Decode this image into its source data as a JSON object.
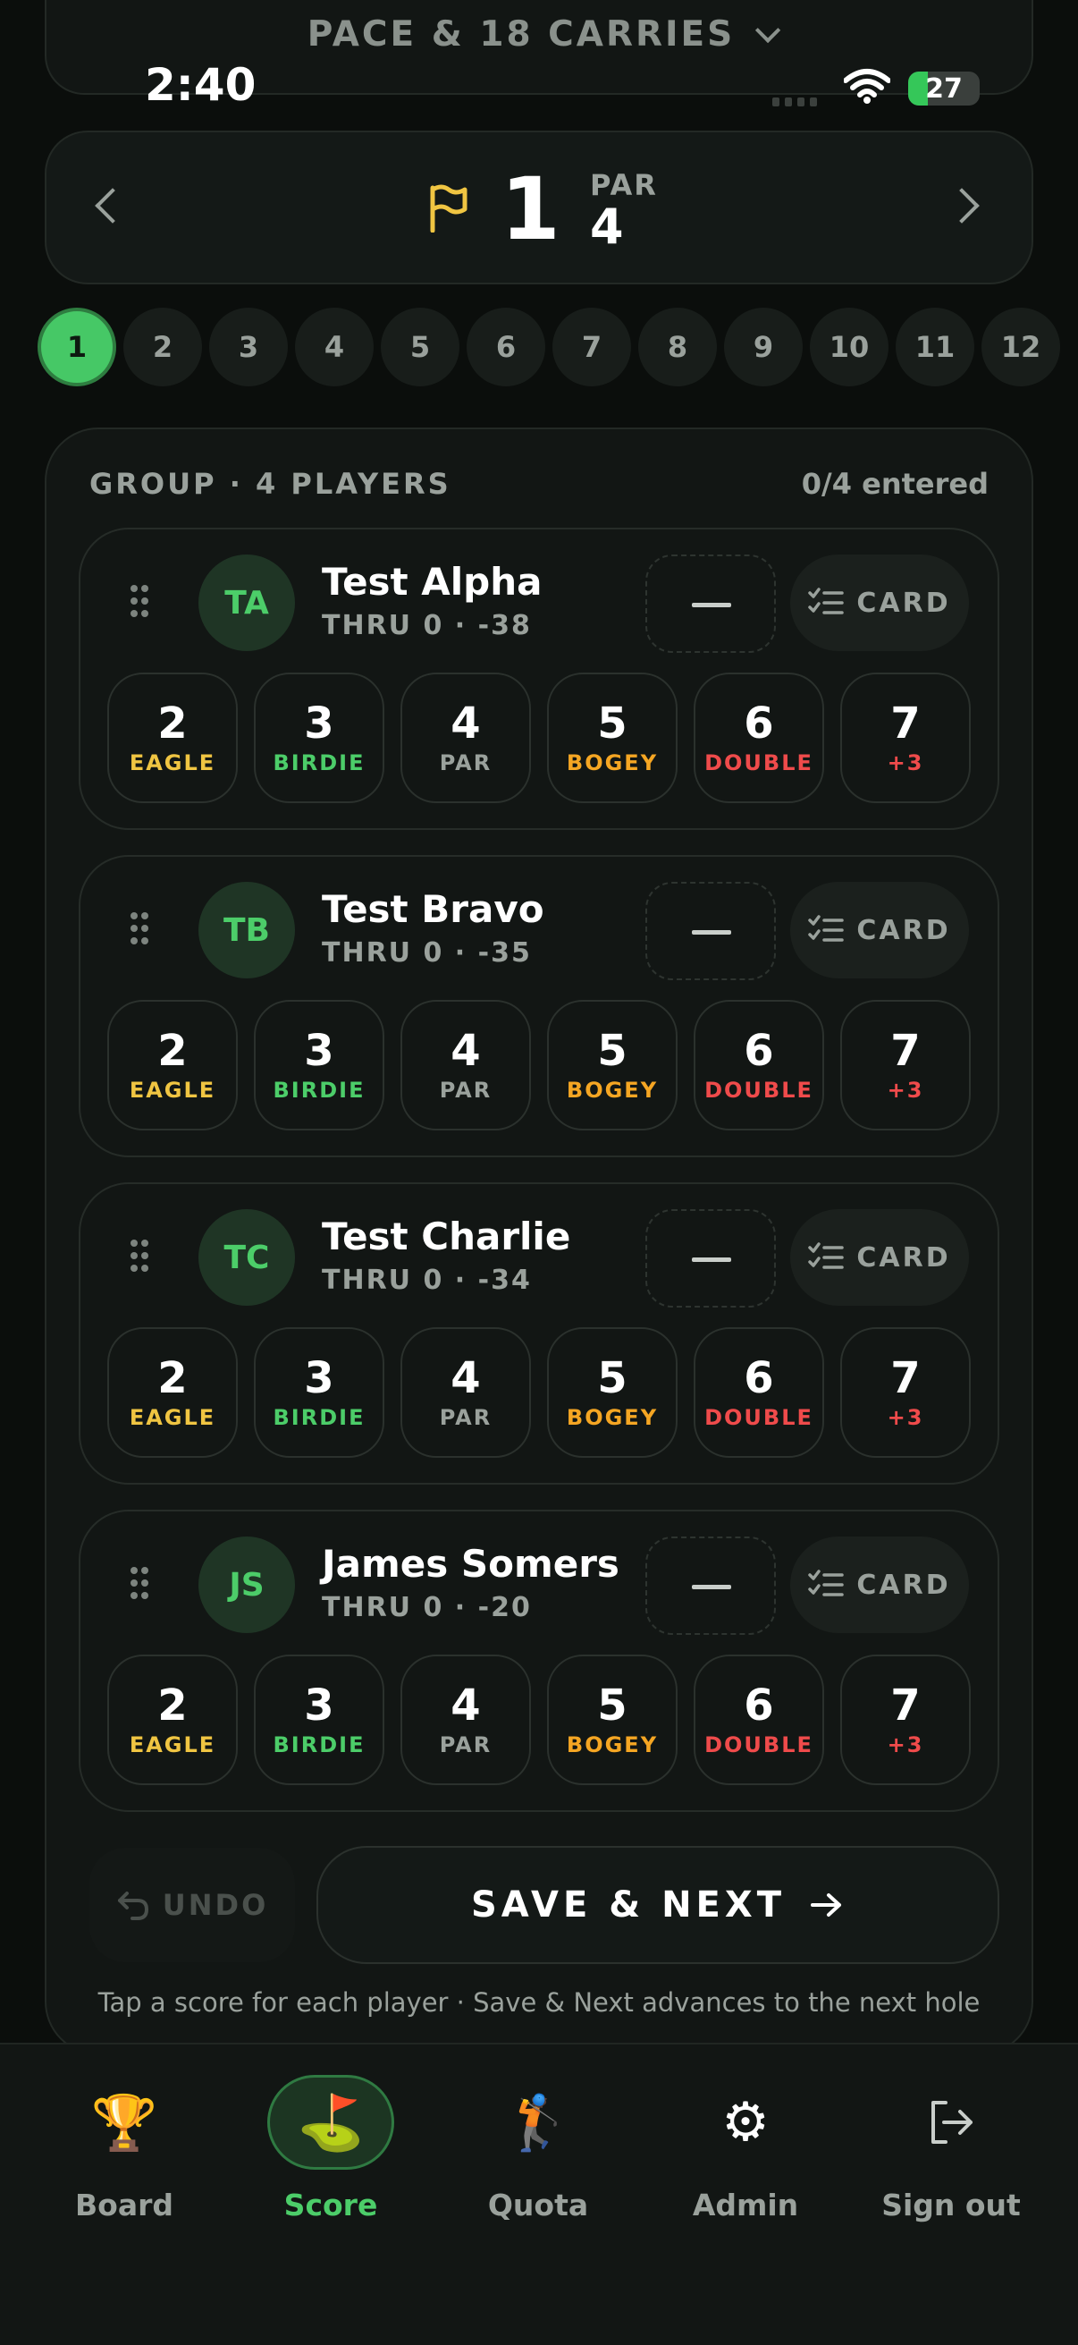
{
  "peek": {
    "title": "PACE & 18 CARRIES"
  },
  "status": {
    "time": "2:40",
    "battery": "27"
  },
  "hole": {
    "number": "1",
    "par_label": "PAR",
    "par": "4"
  },
  "holes": [
    "1",
    "2",
    "3",
    "4",
    "5",
    "6",
    "7",
    "8",
    "9",
    "10",
    "11",
    "12"
  ],
  "active_hole": "1",
  "group": {
    "label": "GROUP · 4 PLAYERS",
    "entered": "0/4 entered"
  },
  "card_label": "CARD",
  "score_options": [
    {
      "n": "2",
      "t": "EAGLE",
      "color": "#f0c542"
    },
    {
      "n": "3",
      "t": "BIRDIE",
      "color": "#4ccd69"
    },
    {
      "n": "4",
      "t": "PAR",
      "color": "#9aa19c"
    },
    {
      "n": "5",
      "t": "BOGEY",
      "color": "#f5a623"
    },
    {
      "n": "6",
      "t": "DOUBLE",
      "color": "#ef4b4b"
    },
    {
      "n": "7",
      "t": "+3",
      "color": "#ef4b4b"
    }
  ],
  "players": [
    {
      "initials": "TA",
      "name": "Test Alpha",
      "meta": "THRU 0 · -38"
    },
    {
      "initials": "TB",
      "name": "Test Bravo",
      "meta": "THRU 0 · -35"
    },
    {
      "initials": "TC",
      "name": "Test Charlie",
      "meta": "THRU 0 · -34"
    },
    {
      "initials": "JS",
      "name": "James Somers",
      "meta": "THRU 0 · -20"
    }
  ],
  "actions": {
    "undo": "UNDO",
    "save": "SAVE & NEXT"
  },
  "hint": "Tap a score for each player · Save & Next advances to the next hole",
  "tabs": [
    {
      "label": "Board",
      "icon": "trophy-icon",
      "glyph": "🏆",
      "active": false
    },
    {
      "label": "Score",
      "icon": "golf-flag-icon",
      "glyph": "⛳",
      "active": true
    },
    {
      "label": "Quota",
      "icon": "golfer-icon",
      "glyph": "🏌",
      "active": false
    },
    {
      "label": "Admin",
      "icon": "gear-icon",
      "glyph": "⚙",
      "active": false
    },
    {
      "label": "Sign out",
      "icon": "sign-out-icon",
      "glyph": "",
      "active": false
    }
  ],
  "colors": {
    "accent": "#46c866",
    "background": "#0b0e0c",
    "card": "#121614"
  }
}
